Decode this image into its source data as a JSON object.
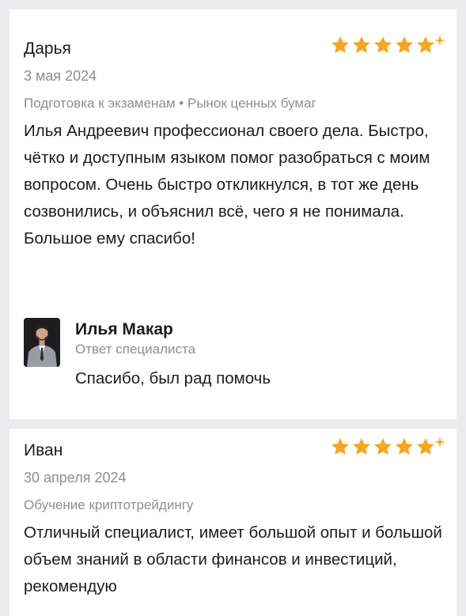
{
  "colors": {
    "star": "#f5a623",
    "muted": "#8e8e93",
    "text": "#1c1c1e",
    "background": "#ececee",
    "card": "#ffffff"
  },
  "reviews": [
    {
      "author": "Дарья",
      "date": "3 мая 2024",
      "category": "Подготовка к экзаменам • Рынок ценных бумаг",
      "rating": 5,
      "text": "Илья Андреевич профессионал своего дела. Быстро, чётко и доступным языком помог разобраться с моим вопросом. Очень быстро откликнулся, в тот же день созвонились, и объяснил всё, чего я не понимала. Большое ему спасибо!",
      "reply": {
        "author": "Илья Макар",
        "role": "Ответ специалиста",
        "text": "Спасибо, был рад помочь"
      }
    },
    {
      "author": "Иван",
      "date": "30 апреля 2024",
      "category": "Обучение криптотрейдингу",
      "rating": 5,
      "text": "Отличный специалист, имеет большой опыт и большой объем знаний в области финансов и инвестиций, рекомендую"
    }
  ]
}
